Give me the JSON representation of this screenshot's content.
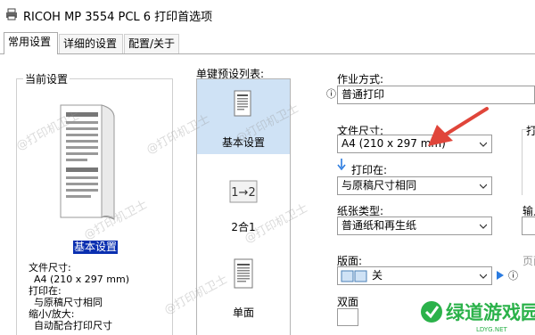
{
  "window": {
    "title": "RICOH MP 3554 PCL 6 打印首选项",
    "icon": "printer-icon"
  },
  "tabs": [
    {
      "label": "常用设置",
      "active": true
    },
    {
      "label": "详细的设置",
      "active": false
    },
    {
      "label": "配置/关于",
      "active": false
    }
  ],
  "current_settings": {
    "title": "当前设置",
    "preset_name": "基本设置",
    "paper_size_label": "文件尺寸:",
    "paper_size_value": "A4 (210 x 297 mm)",
    "print_on_label": "打印在:",
    "print_on_value": "与原稿尺寸相同",
    "scale_label": "缩小/放大:",
    "scale_value": "自动配合打印尺寸"
  },
  "preset_list": {
    "label": "单键预设列表:",
    "items": [
      {
        "label": "基本设置",
        "icon": "document-icon",
        "selected": true
      },
      {
        "label": "2合1",
        "icon": "two-in-one-icon",
        "selected": false
      },
      {
        "label": "单面",
        "icon": "single-sided-icon",
        "selected": false
      }
    ]
  },
  "settings": {
    "job_type": {
      "label": "作业方式:",
      "value": "普通打印"
    },
    "document_size": {
      "label": "文件尺寸:",
      "value": "A4 (210 x 297 mm)"
    },
    "print_on": {
      "label": "打印在:",
      "value": "与原稿尺寸相同"
    },
    "paper_type": {
      "label": "纸张类型:",
      "value": "普通纸和再生纸"
    },
    "page_layout": {
      "label": "版面:",
      "value": "关"
    },
    "duplex": {
      "label": "双面"
    }
  },
  "right_partial": {
    "label_top": "打",
    "label_output": "输入",
    "label_page": "页面"
  },
  "watermark": {
    "text": "@打印机卫士"
  },
  "brand": {
    "name": "绿道游戏园",
    "url": "LDYG.NET"
  },
  "colors": {
    "selection": "#0a2fb0",
    "preset_highlight": "#cfe2f5",
    "annotation_arrow": "#e0453a",
    "brand_green": "#2bb24a"
  }
}
